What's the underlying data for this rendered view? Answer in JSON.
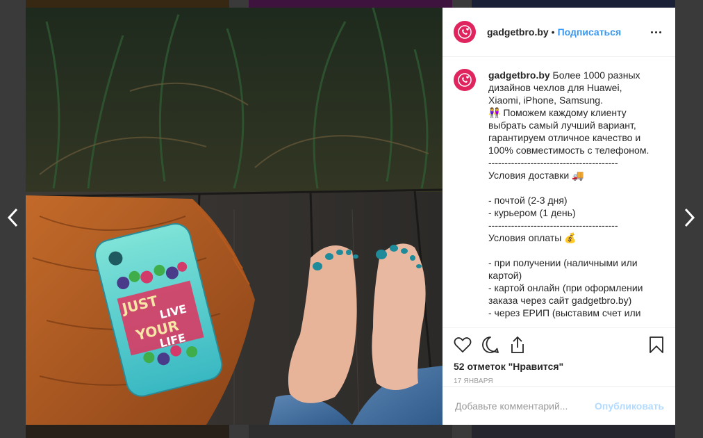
{
  "post": {
    "username": "gadgetbro.by",
    "separator": "•",
    "follow_label": "Подписаться",
    "more_icon": "more-dots-icon",
    "caption_user": "gadgetbro.by",
    "caption_body": " Более 1000 разных дизайнов чехлов для Huawei, Xiaomi, iPhone, Samsung.\n👭 Поможем каждому клиенту выбрать самый лучший вариант, гарантируем отличное качество и 100% совместимость с телефоном.\n----------------------------------------\nУсловия доставки 🚚\n\n- почтой (2-3 дня)\n- курьером (1 день)\n----------------------------------------\nУсловия оплаты 💰\n\n- при получении (наличными или картой)\n- картой онлайн (при оформлении заказа через сайт gadgetbro.by)\n- через ЕРИП (выставим счет или",
    "likes": "52 отметок \"Нравится\"",
    "date": "17 ЯНВАРЯ",
    "comment_placeholder": "Добавьте комментарий...",
    "publish_label": "Опубликовать"
  },
  "media": {
    "phone_case_text": [
      "JUST",
      "LIVE",
      "YOUR",
      "LIFE"
    ]
  },
  "colors": {
    "brand_red": "#e0245e",
    "link_blue": "#3897f0",
    "publish_disabled": "#b3dbff"
  }
}
